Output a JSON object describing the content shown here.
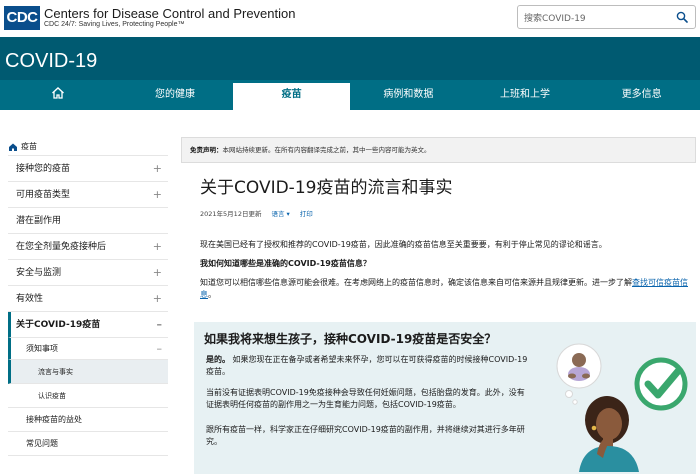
{
  "header": {
    "logo_text": "CDC",
    "org_name": "Centers for Disease Control and Prevention",
    "tagline": "CDC 24/7: Saving Lives, Protecting People™",
    "search_placeholder": "搜索COVID-19"
  },
  "band": {
    "title": "COVID-19"
  },
  "nav": {
    "items": [
      {
        "label": ""
      },
      {
        "label": "您的健康"
      },
      {
        "label": "疫苗"
      },
      {
        "label": "病例和数据"
      },
      {
        "label": "上班和上学"
      },
      {
        "label": "更多信息"
      }
    ]
  },
  "sidebar": {
    "home": "疫苗",
    "items": [
      {
        "label": "接种您的疫苗"
      },
      {
        "label": "可用疫苗类型"
      },
      {
        "label": "潜在副作用"
      },
      {
        "label": "在您全剂量免疫接种后"
      },
      {
        "label": "安全与监测"
      },
      {
        "label": "有效性"
      },
      {
        "label": "关于COVID-19疫苗"
      },
      {
        "label": "须知事项"
      },
      {
        "label": "流言与事实"
      },
      {
        "label": "认识疫苗"
      },
      {
        "label": "接种疫苗的益处"
      },
      {
        "label": "常见问题"
      }
    ]
  },
  "main": {
    "disclaimer_bold": "免责声明：",
    "disclaimer_text": "本网站持续更新。在所有内容翻译完成之前，其中一些内容可能为英文。",
    "title": "关于COVID-19疫苗的流言和事实",
    "updated": "2021年5月12日更新",
    "language": "语言 ▾",
    "print": "打印",
    "p1": "现在美国已经有了授权和推荐的COVID-19疫苗，因此准确的疫苗信息至关重要要，有利于停止常见的谬论和谣言。",
    "p2": "我如何知道哪些是准确的COVID-19疫苗信息？",
    "p3_text": "知道您可以相信哪些信息源可能会很难。在考虑网络上的疫苗信息时，确定该信息来自可信来源并且规律更新。进一步了解",
    "p3_link": "查找可信疫苗信息",
    "p3_end": "。",
    "callout": {
      "title": "如果我将来想生孩子，接种COVID-19疫苗是否安全？",
      "c1_bold": "是的。",
      "c1_text": "如果您现在正在备孕或者希望未来怀孕，您可以在可获得疫苗的时候接种COVID-19疫苗。",
      "c2": "当前没有证据表明COVID-19免疫接种会导致任何妊娠问题，包括胎盘的发育。此外，没有证据表明任何疫苗的副作用之一为生育能力问题，包括COVID-19疫苗。",
      "c3": "跟所有疫苗一样，科学家正在仔细研究COVID-19疫苗的副作用，并将继续对其进行多年研究。"
    }
  },
  "colors": {
    "brand": "#005a71",
    "nav": "#006e85",
    "link": "#0a64ad",
    "callout_bg": "#e7f1f3",
    "check": "#3aa76d"
  }
}
